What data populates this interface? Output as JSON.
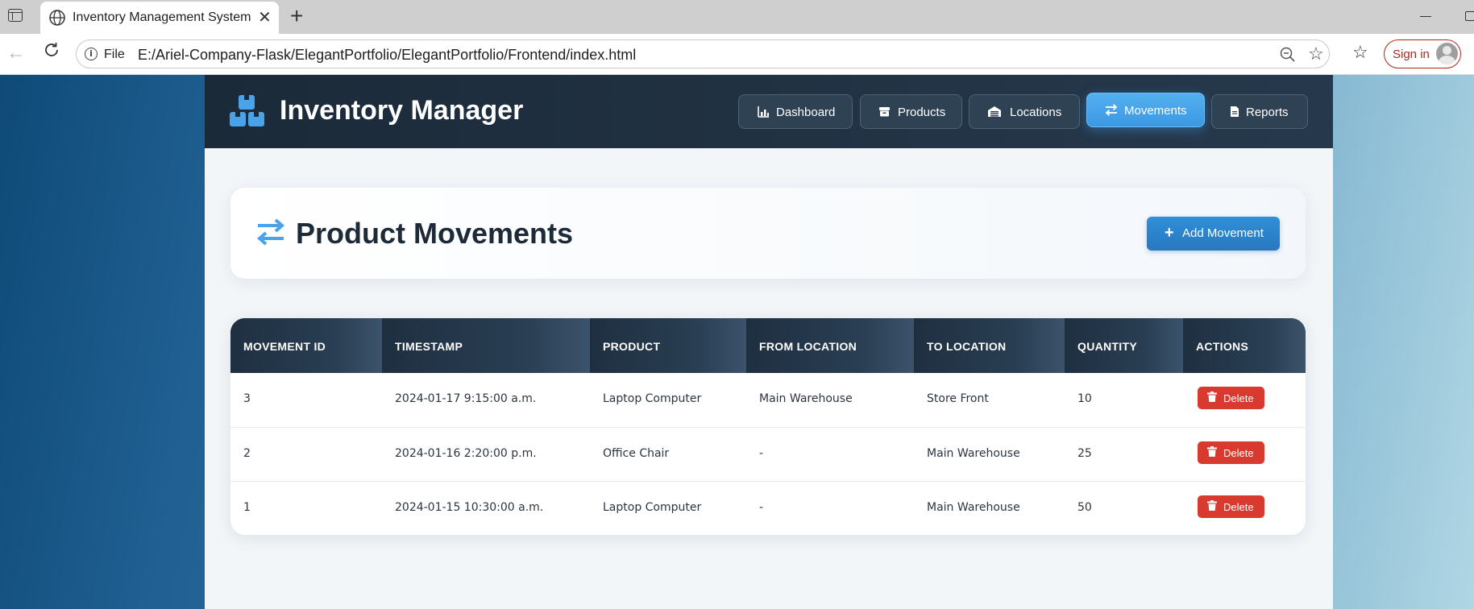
{
  "browser": {
    "tab_title": "Inventory Management System",
    "tab_close": "✕",
    "new_tab": "+",
    "file_label": "File",
    "url": "E:/Ariel-Company-Flask/ElegantPortfolio/ElegantPortfolio/Frontend/index.html",
    "sign_in": "Sign in"
  },
  "header": {
    "brand": "Inventory Manager",
    "nav": [
      {
        "label": "Dashboard",
        "icon": "chart-icon",
        "active": false
      },
      {
        "label": "Products",
        "icon": "box-icon",
        "active": false
      },
      {
        "label": "Locations",
        "icon": "warehouse-icon",
        "active": false
      },
      {
        "label": "Movements",
        "icon": "swap-icon",
        "active": true
      },
      {
        "label": "Reports",
        "icon": "file-icon",
        "active": false
      }
    ]
  },
  "page": {
    "title": "Product Movements",
    "add_button": "Add Movement"
  },
  "table": {
    "columns": [
      "MOVEMENT ID",
      "TIMESTAMP",
      "PRODUCT",
      "FROM LOCATION",
      "TO LOCATION",
      "QUANTITY",
      "ACTIONS"
    ],
    "rows": [
      {
        "id": "3",
        "timestamp": "2024-01-17 9:15:00 a.m.",
        "product": "Laptop Computer",
        "from": "Main Warehouse",
        "to": "Store Front",
        "quantity": "10",
        "action": "Delete"
      },
      {
        "id": "2",
        "timestamp": "2024-01-16 2:20:00 p.m.",
        "product": "Office Chair",
        "from": "-",
        "to": "Main Warehouse",
        "quantity": "25",
        "action": "Delete"
      },
      {
        "id": "1",
        "timestamp": "2024-01-15 10:30:00 a.m.",
        "product": "Laptop Computer",
        "from": "-",
        "to": "Main Warehouse",
        "quantity": "50",
        "action": "Delete"
      }
    ]
  },
  "colors": {
    "accent": "#3b98e2",
    "header_bg": "#1b2a39",
    "delete": "#d93a2f"
  }
}
